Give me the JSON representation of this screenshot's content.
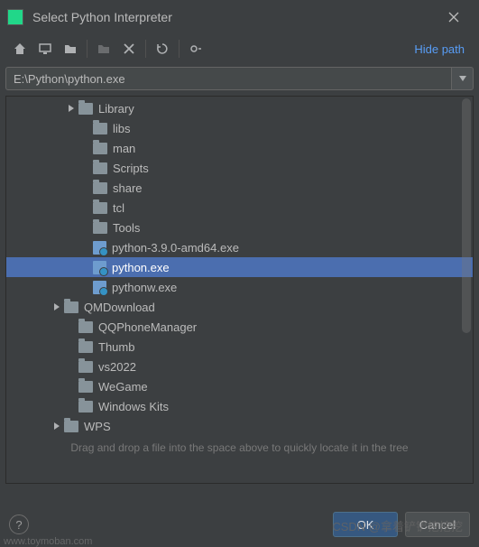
{
  "titlebar": {
    "title": "Select Python Interpreter"
  },
  "toolbar": {
    "hide_path": "Hide path"
  },
  "path": {
    "value": "E:\\Python\\python.exe"
  },
  "tree": {
    "items": [
      {
        "indent": 64,
        "expandable": true,
        "expanded": false,
        "type": "folder",
        "label": "Library"
      },
      {
        "indent": 80,
        "expandable": false,
        "expanded": false,
        "type": "folder",
        "label": "libs"
      },
      {
        "indent": 80,
        "expandable": false,
        "expanded": false,
        "type": "folder",
        "label": "man"
      },
      {
        "indent": 80,
        "expandable": false,
        "expanded": false,
        "type": "folder",
        "label": "Scripts"
      },
      {
        "indent": 80,
        "expandable": false,
        "expanded": false,
        "type": "folder",
        "label": "share"
      },
      {
        "indent": 80,
        "expandable": false,
        "expanded": false,
        "type": "folder",
        "label": "tcl"
      },
      {
        "indent": 80,
        "expandable": false,
        "expanded": false,
        "type": "folder",
        "label": "Tools"
      },
      {
        "indent": 80,
        "expandable": false,
        "expanded": false,
        "type": "file",
        "label": "python-3.9.0-amd64.exe"
      },
      {
        "indent": 80,
        "expandable": false,
        "expanded": false,
        "type": "file",
        "label": "python.exe",
        "selected": true
      },
      {
        "indent": 80,
        "expandable": false,
        "expanded": false,
        "type": "file",
        "label": "pythonw.exe"
      },
      {
        "indent": 48,
        "expandable": true,
        "expanded": false,
        "type": "folder",
        "label": "QMDownload"
      },
      {
        "indent": 64,
        "expandable": false,
        "expanded": false,
        "type": "folder",
        "label": "QQPhoneManager"
      },
      {
        "indent": 64,
        "expandable": false,
        "expanded": false,
        "type": "folder",
        "label": "Thumb"
      },
      {
        "indent": 64,
        "expandable": false,
        "expanded": false,
        "type": "folder",
        "label": "vs2022"
      },
      {
        "indent": 64,
        "expandable": false,
        "expanded": false,
        "type": "folder",
        "label": "WeGame"
      },
      {
        "indent": 64,
        "expandable": false,
        "expanded": false,
        "type": "folder",
        "label": "Windows Kits"
      },
      {
        "indent": 48,
        "expandable": true,
        "expanded": false,
        "type": "folder",
        "label": "WPS"
      }
    ],
    "hint": "Drag and drop a file into the space above to quickly locate it in the tree"
  },
  "buttons": {
    "help": "?",
    "ok": "OK",
    "cancel": "Cancel"
  },
  "watermark": {
    "author": "CSDN @拿着铲铲挖挖挖",
    "site": "www.toymoban.com"
  },
  "colors": {
    "accent": "#4b6eaf",
    "link": "#589df6",
    "background": "#3c3f41"
  }
}
